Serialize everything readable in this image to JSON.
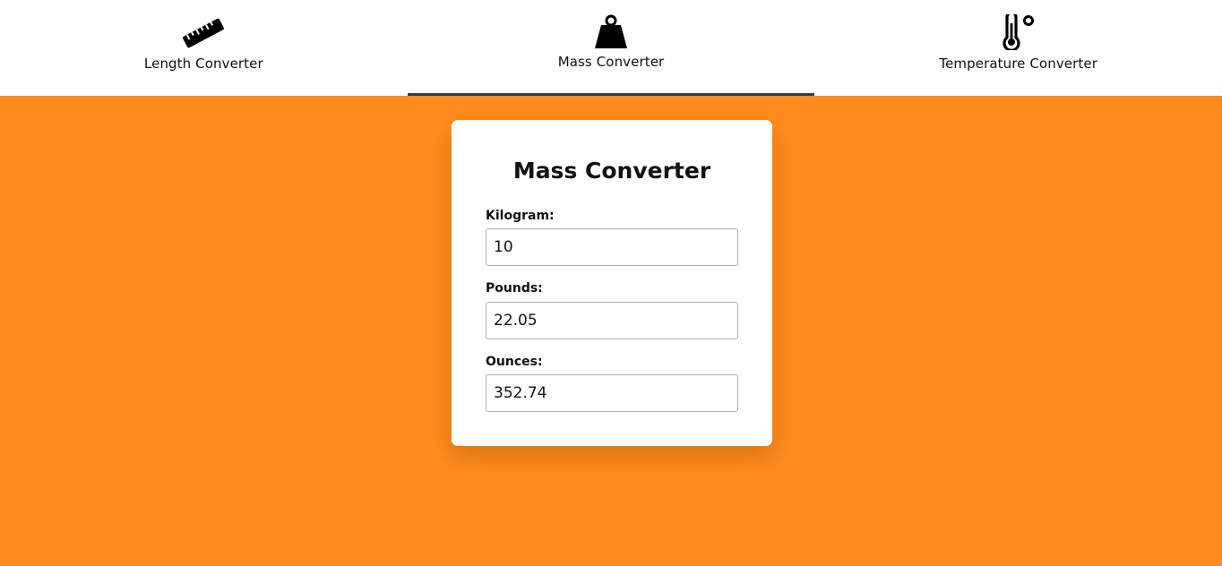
{
  "tabs": [
    {
      "label": "Length Converter",
      "icon": "ruler-icon",
      "active": false
    },
    {
      "label": "Mass Converter",
      "icon": "weight-icon",
      "active": true
    },
    {
      "label": "Temperature Converter",
      "icon": "thermometer-icon",
      "active": false
    }
  ],
  "card": {
    "title": "Mass Converter",
    "fields": [
      {
        "label": "Kilogram:",
        "value": "10"
      },
      {
        "label": "Pounds:",
        "value": "22.05"
      },
      {
        "label": "Ounces:",
        "value": "352.74"
      }
    ]
  },
  "colors": {
    "background": "#ff8c1c",
    "card": "#ffffff",
    "active_indicator": "#3a3a3a"
  }
}
